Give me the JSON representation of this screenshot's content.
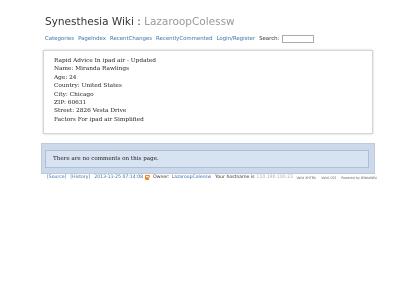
{
  "header": {
    "site_title": "Synesthesia Wiki",
    "separator": " : ",
    "page_name": "LazaroopColessw"
  },
  "nav": {
    "items": [
      "Categories",
      "PageIndex",
      "RecentChanges",
      "RecentlyCommented",
      "Login/Register"
    ],
    "search_label": "Search:"
  },
  "content": {
    "lines": [
      "Rapid Advice In ipad air - Updated",
      "Name: Miranda Rawlings",
      "Age: 24",
      "Country: United States",
      "City: Chicago",
      "ZIP: 60631",
      "Street: 2826 Vesta Drive",
      "Factors For ipad air Simplified"
    ]
  },
  "comments": {
    "text": "There are no comments on this page."
  },
  "footer": {
    "source": "[Source]",
    "history": "[History]",
    "timestamp": "2013-11-25 07:14:08",
    "owner_label": "Owner:",
    "owner": "LazaroopColessw",
    "hostname_label": "Your hostname is",
    "hostname": "110.190.100.23",
    "right": [
      "Valid XHTML",
      "Valid CSS",
      "Powered by WikkaWiki"
    ]
  },
  "colors": {
    "link": "#3a6fa8",
    "comment_bg": "#ccd9ea",
    "rss": "#f08a24"
  }
}
